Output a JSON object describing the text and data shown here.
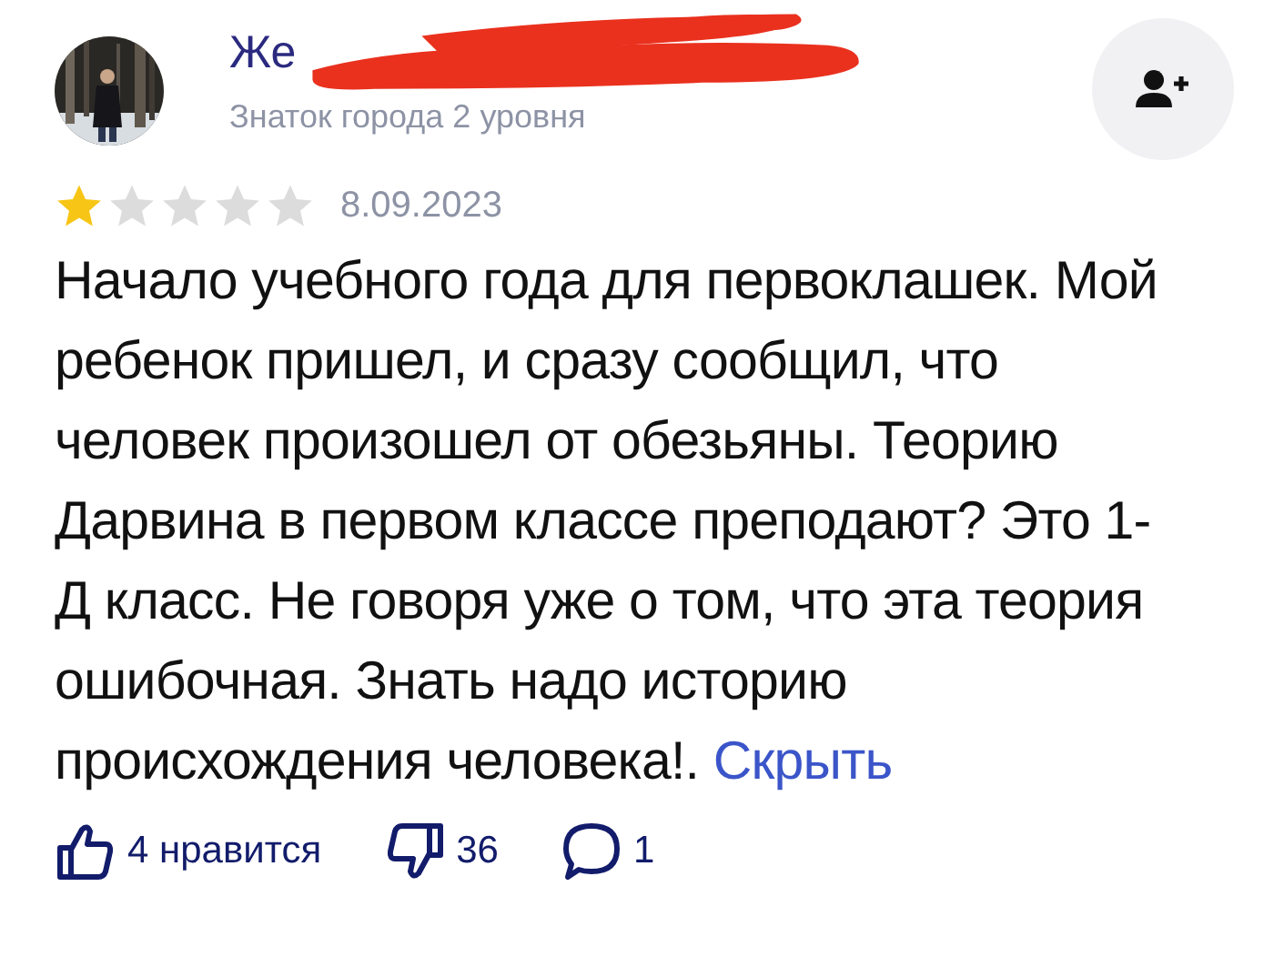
{
  "author": {
    "name": "Же",
    "subtitle": "Знаток города 2 уровня"
  },
  "review": {
    "stars": 1,
    "date": "8.09.2023",
    "text": "Начало учебного года для первоклашек. Мой ребенок пришел, и сразу сообщил, что человек произошел от обезьяны. Теорию Дарвина в первом классе преподают? Это 1-Д класс. Не говоря уже о том, что эта теория ошибочная. Знать надо историю происхождения человека!.",
    "link": "Скрыть"
  },
  "actions": [
    {
      "kind": "like",
      "label": "4 нравится"
    },
    {
      "kind": "dislike",
      "label": "36"
    },
    {
      "kind": "comment",
      "label": "1"
    }
  ]
}
